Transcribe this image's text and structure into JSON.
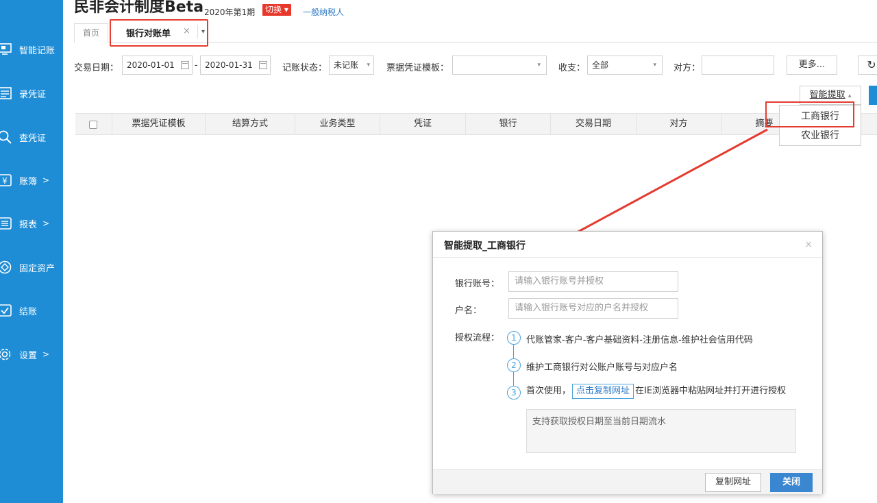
{
  "header": {
    "app_title": "民非会计制度Beta",
    "period": "2020年第1期",
    "switch_label": "切换 ▾",
    "taxpayer_type": "一般纳税人"
  },
  "sidebar": {
    "items": [
      {
        "label": "智能记账",
        "icon": "smart-booking-icon"
      },
      {
        "label": "录凭证",
        "icon": "voucher-entry-icon"
      },
      {
        "label": "查凭证",
        "icon": "search-icon"
      },
      {
        "label": "账簿",
        "icon": "yuan-icon",
        "arrow": ">"
      },
      {
        "label": "报表",
        "icon": "report-icon",
        "arrow": ">"
      },
      {
        "label": "固定资产",
        "icon": "asset-icon"
      },
      {
        "label": "结账",
        "icon": "check-icon"
      },
      {
        "label": "设置",
        "icon": "gear-icon",
        "arrow": ">"
      }
    ]
  },
  "tabs": {
    "home": "首页",
    "active": "银行对账单",
    "close": "×",
    "more": "▾"
  },
  "filters": {
    "date_label": "交易日期：",
    "date_from": "2020-01-01",
    "date_sep": "-",
    "date_to": "2020-01-31",
    "status_label": "记账状态：",
    "status_value": "未记账",
    "template_label": "票据凭证模板：",
    "template_value": "",
    "income_label": "收支：",
    "income_value": "全部",
    "party_label": "对方：",
    "party_value": "",
    "more_button": "更多...",
    "refresh_icon": "↻",
    "smart_extract_button": "智能提取",
    "smart_extract_caret": "▴"
  },
  "table": {
    "columns": [
      "票据凭证模板",
      "结算方式",
      "业务类型",
      "凭证",
      "银行",
      "交易日期",
      "对方",
      "摘要"
    ]
  },
  "bank_dropdown": {
    "options": [
      "工商银行",
      "农业银行"
    ]
  },
  "modal": {
    "title": "智能提取_工商银行",
    "close_x": "×",
    "account_label": "银行账号：",
    "account_placeholder": "请输入银行账号并授权",
    "name_label": "户名：",
    "name_placeholder": "请输入银行账号对应的户名并授权",
    "flow_label": "授权流程：",
    "steps": [
      {
        "num": "1",
        "text": "代账管家-客户-客户基础资料-注册信息-维护社会信用代码"
      },
      {
        "num": "2",
        "text": "维护工商银行对公账户账号与对应户名"
      },
      {
        "num": "3",
        "text_before": "首次使用，",
        "link": "点击复制网址",
        "text_after": "在IE浏览器中粘贴网址并打开进行授权"
      }
    ],
    "note": "支持获取授权日期至当前日期流水",
    "copy_button": "复制网址",
    "close_button": "关闭"
  },
  "colors": {
    "sidebar_bg": "#1f8dd6",
    "highlight_red": "#e53a2f",
    "primary_blue": "#3a86d1"
  }
}
